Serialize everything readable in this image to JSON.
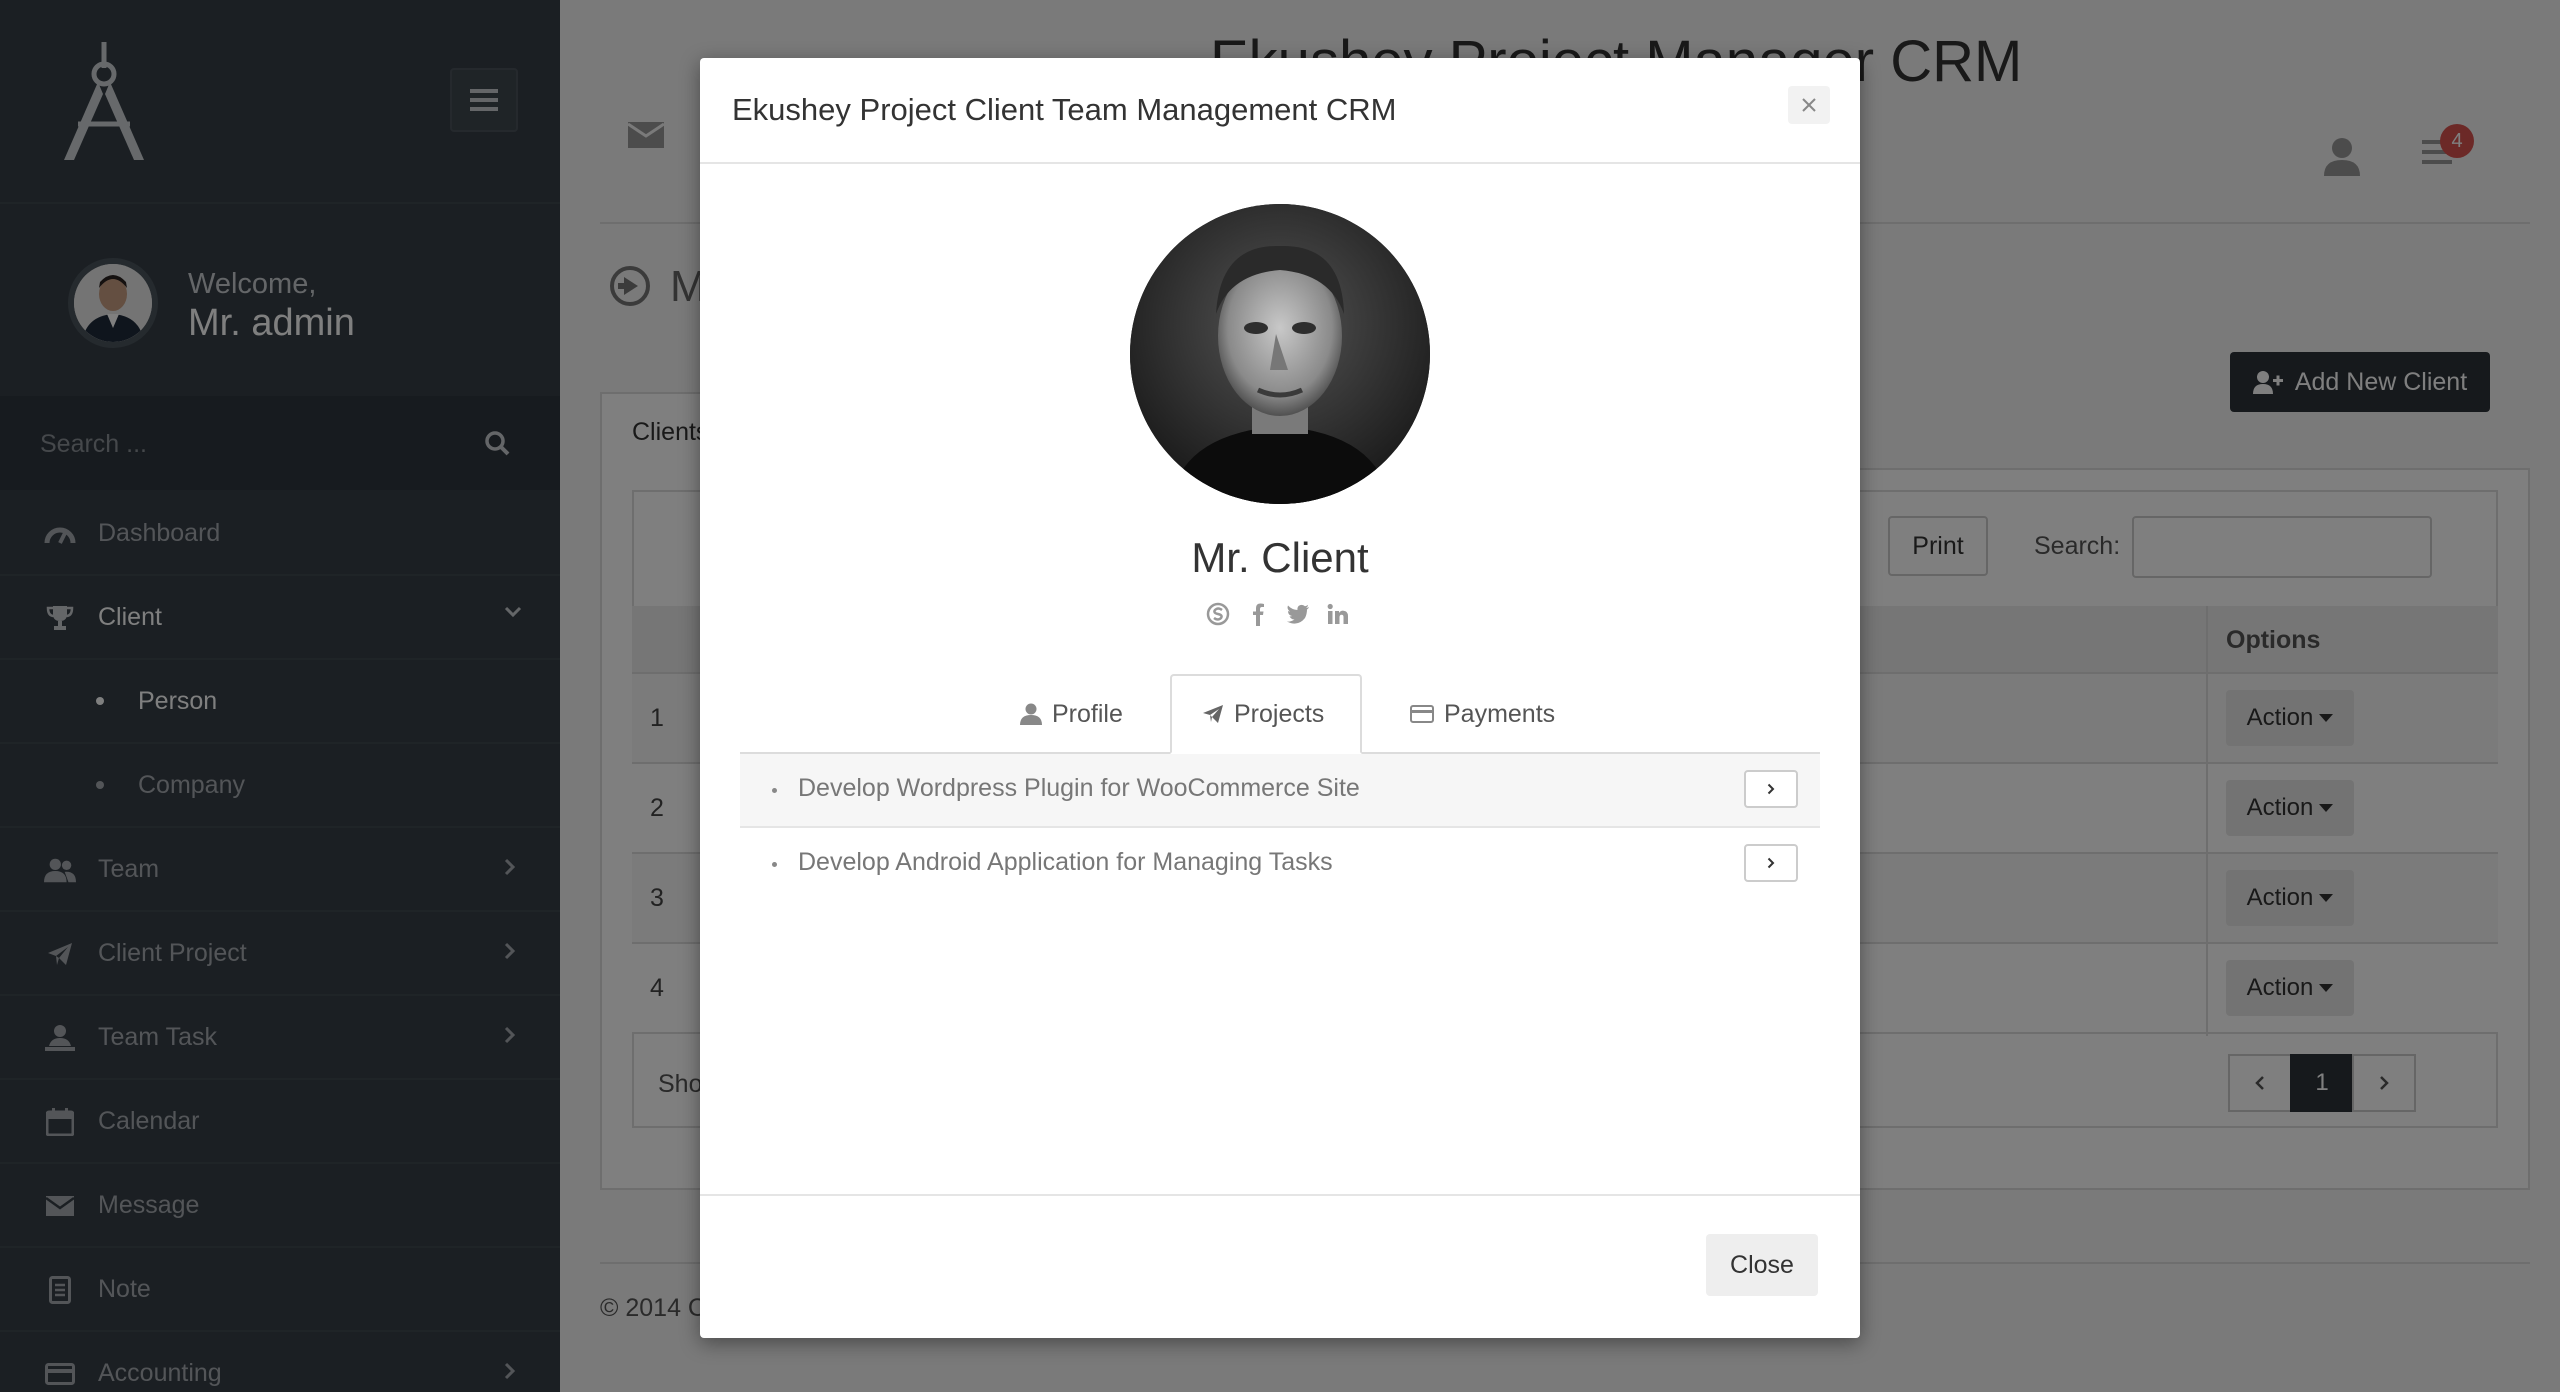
{
  "app": {
    "title": "Ekushey Project Manager CRM",
    "page_title": "M",
    "notification_count": "4"
  },
  "sidebar": {
    "welcome": "Welcome,",
    "user_name": "Mr. admin",
    "search_placeholder": "Search ...",
    "items": [
      {
        "label": "Dashboard",
        "icon": "dashboard-icon"
      },
      {
        "label": "Client",
        "icon": "trophy-icon"
      },
      {
        "label": "Team",
        "icon": "team-icon"
      },
      {
        "label": "Client Project",
        "icon": "paper-plane-icon"
      },
      {
        "label": "Team Task",
        "icon": "task-icon"
      },
      {
        "label": "Calendar",
        "icon": "calendar-icon"
      },
      {
        "label": "Message",
        "icon": "envelope-icon"
      },
      {
        "label": "Note",
        "icon": "note-icon"
      },
      {
        "label": "Accounting",
        "icon": "credit-card-icon"
      }
    ],
    "sub_items": [
      {
        "label": "Person"
      },
      {
        "label": "Company"
      }
    ]
  },
  "main": {
    "add_button": "Add New Client",
    "tab_clients": "Clients",
    "print": "Print",
    "search_label": "Search:",
    "options_header": "Options",
    "rows": [
      {
        "num": "1",
        "action": "Action"
      },
      {
        "num": "2",
        "action": "Action"
      },
      {
        "num": "3",
        "action": "Action"
      },
      {
        "num": "4",
        "action": "Action"
      }
    ],
    "show_text": "Sho",
    "pager_current": "1",
    "footer": "© 2014 C"
  },
  "modal": {
    "title": "Ekushey Project Client Team Management CRM",
    "client_name": "Mr. Client",
    "tabs": [
      {
        "label": "Profile"
      },
      {
        "label": "Projects"
      },
      {
        "label": "Payments"
      }
    ],
    "active_tab": "Projects",
    "projects": [
      {
        "label": "Develop Wordpress Plugin for WooCommerce Site"
      },
      {
        "label": "Develop Android Application for Managing Tasks"
      }
    ],
    "close_button": "Close"
  },
  "colors": {
    "sidebar_bg": "#363f47",
    "dark_button": "#2c3339",
    "badge": "#d9534f"
  }
}
